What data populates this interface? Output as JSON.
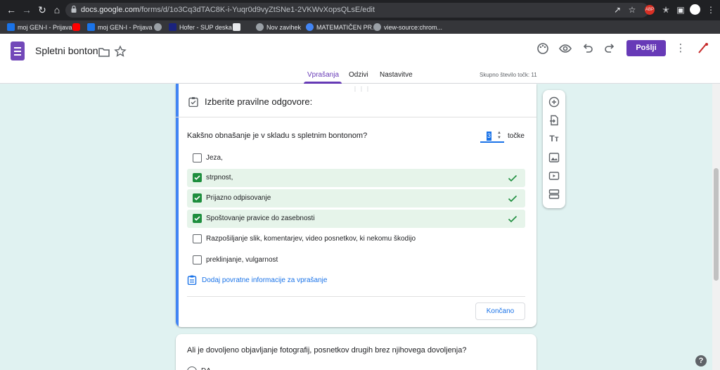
{
  "browser": {
    "url_host": "docs.google.com",
    "url_path": "/forms/d/1o3Cq3dTAC8K-i-Yuqr0d9vyZtSNe1-2VKWvXopsQLsE/edit",
    "bookmarks": [
      {
        "label": "moj GEN-I - Prijava",
        "color": "#1a73e8"
      },
      {
        "label": "",
        "color": "#ff0000"
      },
      {
        "label": "moj GEN-I - Prijava",
        "color": "#1a73e8"
      },
      {
        "label": "",
        "color": "#9aa0a6"
      },
      {
        "label": "Hofer - SUP deska",
        "color": "#1a237e"
      },
      {
        "label": "",
        "color": "#e8eaed"
      },
      {
        "label": "Nov zavihek",
        "color": "#9aa0a6"
      },
      {
        "label": "MATEMATIČEN PR...",
        "color": "#4285f4"
      },
      {
        "label": "view-source:chrom...",
        "color": "#9aa0a6"
      }
    ]
  },
  "header": {
    "title": "Spletni bonton",
    "send_label": "Pošlji",
    "tabs": [
      {
        "label": "Vprašanja",
        "active": true
      },
      {
        "label": "Odzivi",
        "active": false
      },
      {
        "label": "Nastavitve",
        "active": false
      }
    ],
    "total_points": "Skupno število točk: 11",
    "accent_color": "#673ab7"
  },
  "question": {
    "answer_key_title": "Izberite pravilne odgovore:",
    "title": "Kakšno obnašanje je v skladu s spletnim bontonom?",
    "points_value": "3",
    "points_label": "točke",
    "options": [
      {
        "label": "Jeza,",
        "correct": false
      },
      {
        "label": "strpnost,",
        "correct": true
      },
      {
        "label": "Prijazno odpisovanje",
        "correct": true
      },
      {
        "label": "Spoštovanje pravice do zasebnosti",
        "correct": true
      },
      {
        "label": "Razpošiljanje slik, komentarjev, video posnetkov, ki nekomu škodijo",
        "correct": false
      },
      {
        "label": "preklinjanje, vulgarnost",
        "correct": false
      }
    ],
    "feedback_link": "Dodaj povratne informacije za vprašanje",
    "done_label": "Končano"
  },
  "next_question": {
    "title": "Ali je dovoljeno  objavljanje fotografij, posnetkov drugih brez njihovega dovoljenja?",
    "first_option": "DA"
  },
  "help_label": "?"
}
